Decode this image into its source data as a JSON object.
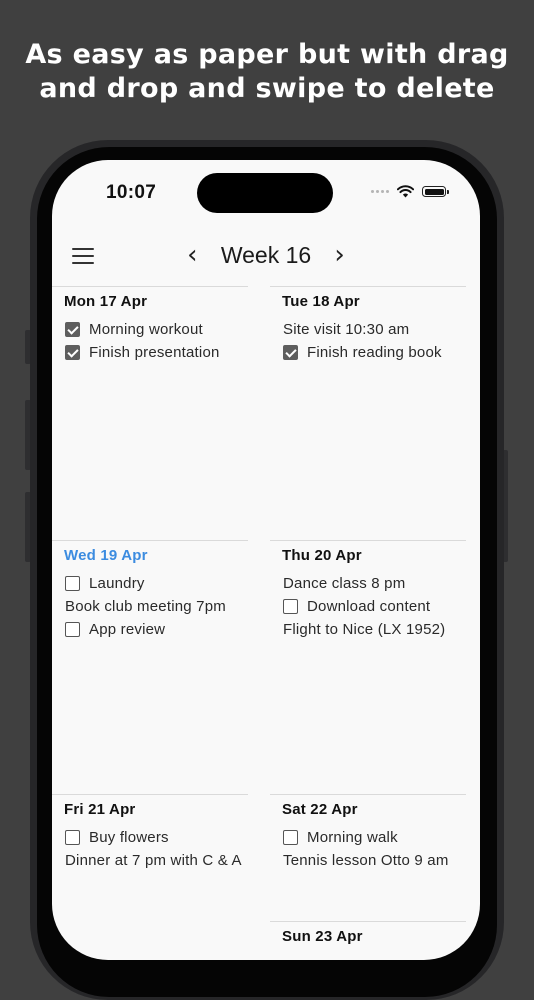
{
  "banner": {
    "line1": "As easy as paper but with drag",
    "line2": "and drop and swipe to delete"
  },
  "status_bar": {
    "time": "10:07"
  },
  "header": {
    "prev_icon": "chevron-left-icon",
    "next_icon": "chevron-right-icon",
    "menu_icon": "hamburger-menu-icon",
    "week_label": "Week 16"
  },
  "colors": {
    "today_accent": "#3c8ce0",
    "checkbox_checked": "#5e5e5e"
  },
  "days": [
    {
      "title": "Mon 17 Apr",
      "today": false,
      "tasks": [
        {
          "label": "Morning workout",
          "type": "todo",
          "checked": true
        },
        {
          "label": "Finish presentation",
          "type": "todo",
          "checked": true
        }
      ]
    },
    {
      "title": "Tue 18 Apr",
      "today": false,
      "tasks": [
        {
          "label": "Site visit 10:30 am",
          "type": "event"
        },
        {
          "label": "Finish reading book",
          "type": "todo",
          "checked": true
        }
      ]
    },
    {
      "title": "Wed 19 Apr",
      "today": true,
      "tasks": [
        {
          "label": "Laundry",
          "type": "todo",
          "checked": false
        },
        {
          "label": "Book club meeting 7pm",
          "type": "event"
        },
        {
          "label": "App review",
          "type": "todo",
          "checked": false
        }
      ]
    },
    {
      "title": "Thu 20 Apr",
      "today": false,
      "tasks": [
        {
          "label": "Dance class 8 pm",
          "type": "event"
        },
        {
          "label": "Download content",
          "type": "todo",
          "checked": false
        },
        {
          "label": "Flight to Nice (LX 1952)",
          "type": "event"
        }
      ]
    },
    {
      "title": "Fri 21 Apr",
      "today": false,
      "tasks": [
        {
          "label": "Buy flowers",
          "type": "todo",
          "checked": false
        },
        {
          "label": "Dinner at 7 pm with C & A",
          "type": "event"
        }
      ]
    },
    {
      "title": "Sat 22 Apr",
      "today": false,
      "tasks": [
        {
          "label": "Morning walk",
          "type": "todo",
          "checked": false
        },
        {
          "label": "Tennis lesson Otto 9 am",
          "type": "event"
        }
      ]
    },
    {
      "title": "Sun 23 Apr",
      "today": false,
      "tasks": []
    }
  ]
}
